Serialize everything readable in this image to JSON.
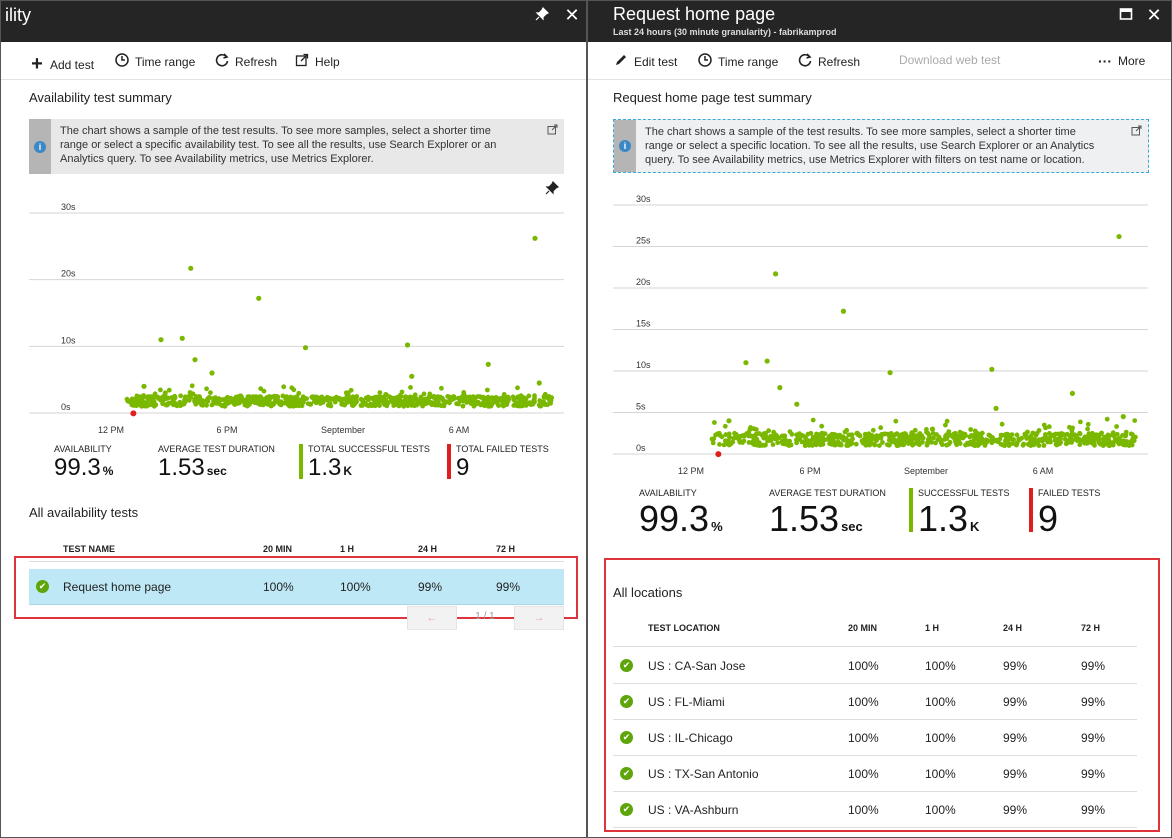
{
  "left": {
    "title": "ility",
    "toolbar": {
      "add_test": "Add test",
      "time_range": "Time range",
      "refresh": "Refresh",
      "help": "Help"
    },
    "summary_title": "Availability test summary",
    "info_text": [
      "The chart shows a sample of the test results. To see more samples, select a shorter time",
      "range or select a specific availability test. To see all the results, use Search Explorer or an",
      "Analytics query. To see Availability metrics, use Metrics Explorer."
    ],
    "stats": [
      {
        "label": "AVAILABILITY",
        "value": "99.3",
        "unit": "%"
      },
      {
        "label": "AVERAGE TEST DURATION",
        "value": "1.53",
        "unit": "sec"
      },
      {
        "label": "TOTAL SUCCESSFUL TESTS",
        "value": "1.3",
        "unit": "K"
      },
      {
        "label": "TOTAL FAILED TESTS",
        "value": "9",
        "unit": ""
      }
    ],
    "table_title": "All availability tests",
    "table": {
      "headers": [
        "TEST NAME",
        "20 MIN",
        "1 H",
        "24 H",
        "72 H"
      ],
      "rows": [
        {
          "name": "Request home page",
          "v20": "100%",
          "v1h": "100%",
          "v24": "99%",
          "v72": "99%"
        }
      ]
    },
    "pager": {
      "text": "1 / 1",
      "prev": "←",
      "next": "→"
    }
  },
  "right": {
    "title": "Request home page",
    "subtitle": "Last 24 hours (30 minute granularity) - fabrikamprod",
    "toolbar": {
      "edit_test": "Edit test",
      "time_range": "Time range",
      "refresh": "Refresh",
      "download": "Download web test",
      "more": "More"
    },
    "summary_title": "Request home page test summary",
    "info_text": [
      "The chart shows a sample of the test results. To see more samples, select a shorter time",
      "range or select a specific location. To see all the results, use Search Explorer or an Analytics",
      "query. To see Availability metrics, use Metrics Explorer with filters on test name or location."
    ],
    "stats": [
      {
        "label": "AVAILABILITY",
        "value": "99.3",
        "unit": "%"
      },
      {
        "label": "AVERAGE TEST DURATION",
        "value": "1.53",
        "unit": "sec"
      },
      {
        "label": "SUCCESSFUL TESTS",
        "value": "1.3",
        "unit": "K"
      },
      {
        "label": "FAILED TESTS",
        "value": "9",
        "unit": ""
      }
    ],
    "table_title": "All locations",
    "table": {
      "headers": [
        "TEST LOCATION",
        "20 MIN",
        "1 H",
        "24 H",
        "72 H"
      ],
      "rows": [
        {
          "name": "US : CA-San Jose",
          "v20": "100%",
          "v1h": "100%",
          "v24": "99%",
          "v72": "99%"
        },
        {
          "name": "US : FL-Miami",
          "v20": "100%",
          "v1h": "100%",
          "v24": "99%",
          "v72": "99%"
        },
        {
          "name": "US : IL-Chicago",
          "v20": "100%",
          "v1h": "100%",
          "v24": "99%",
          "v72": "99%"
        },
        {
          "name": "US : TX-San Antonio",
          "v20": "100%",
          "v1h": "100%",
          "v24": "99%",
          "v72": "99%"
        },
        {
          "name": "US : VA-Ashburn",
          "v20": "100%",
          "v1h": "100%",
          "v24": "99%",
          "v72": "99%"
        }
      ]
    }
  },
  "colors": {
    "success": "#7ab800",
    "failed": "#e01e1e",
    "check": "#5ea50a",
    "selected_row": "#bfe8f6",
    "highlight": "#e0343c"
  },
  "chart_data": [
    {
      "type": "scatter",
      "title": "",
      "xlabel": "",
      "ylabel": "",
      "y_ticks": [
        "0s",
        "10s",
        "20s",
        "30s"
      ],
      "ylim": [
        0,
        30
      ],
      "x_ticks": [
        "12 PM",
        "6 PM",
        "September",
        "6 AM"
      ],
      "series": [
        {
          "values": [
            [
              0.04,
              4
            ],
            [
              0.08,
              11
            ],
            [
              0.09,
              3
            ],
            [
              0.13,
              11.2
            ],
            [
              0.15,
              21.7
            ],
            [
              0.16,
              8
            ],
            [
              0.2,
              6
            ],
            [
              0.31,
              17.2
            ],
            [
              0.42,
              9.8
            ],
            [
              0.52,
              3
            ],
            [
              0.66,
              10.2
            ],
            [
              0.67,
              5.5
            ],
            [
              0.85,
              7.3
            ],
            [
              0.96,
              26.2
            ],
            [
              0.97,
              4.5
            ]
          ]
        },
        {
          "values": [
            [
              0.015,
              0.1
            ]
          ]
        }
      ],
      "baseline_band": [
        1,
        2.5
      ]
    },
    {
      "type": "scatter",
      "title": "",
      "xlabel": "",
      "ylabel": "",
      "y_ticks": [
        "0s",
        "5s",
        "10s",
        "15s",
        "20s",
        "25s",
        "30s"
      ],
      "ylim": [
        0,
        30
      ],
      "x_ticks": [
        "12 PM",
        "6 PM",
        "September",
        "6 AM"
      ],
      "series": [
        {
          "values": [
            [
              0.04,
              4
            ],
            [
              0.08,
              11
            ],
            [
              0.09,
              3
            ],
            [
              0.13,
              11.2
            ],
            [
              0.15,
              21.7
            ],
            [
              0.16,
              8
            ],
            [
              0.2,
              6
            ],
            [
              0.31,
              17.2
            ],
            [
              0.42,
              9.8
            ],
            [
              0.52,
              3
            ],
            [
              0.66,
              10.2
            ],
            [
              0.67,
              5.5
            ],
            [
              0.85,
              7.3
            ],
            [
              0.96,
              26.2
            ],
            [
              0.97,
              4.5
            ]
          ]
        },
        {
          "values": [
            [
              0.015,
              0.1
            ]
          ]
        }
      ],
      "baseline_band": [
        1,
        2.5
      ]
    }
  ]
}
